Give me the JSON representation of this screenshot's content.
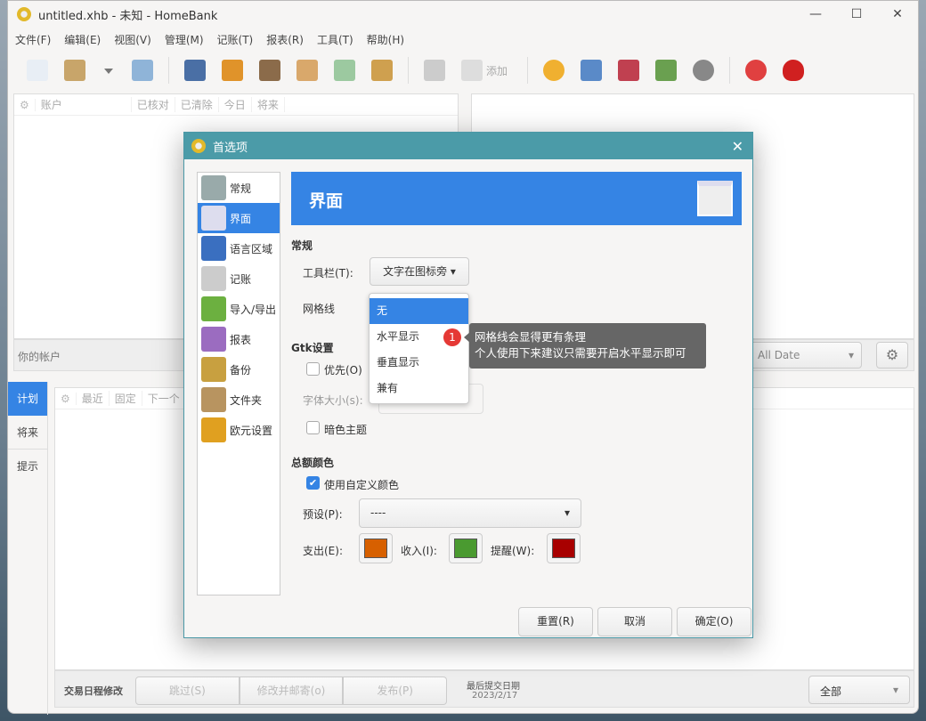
{
  "window": {
    "title": "untitled.xhb - 未知 - HomeBank",
    "controls": [
      "—",
      "☐",
      "✕"
    ]
  },
  "menu": [
    "文件(F)",
    "编辑(E)",
    "视图(V)",
    "管理(M)",
    "记账(T)",
    "报表(R)",
    "工具(T)",
    "帮助(H)"
  ],
  "toolbar": {
    "add_label": "添加",
    "colors": {
      "new": "#e8eef5",
      "open": "#c8a56a",
      "save": "#8fb4d8",
      "accounts": "#4a6fa5",
      "payees": "#e0932a",
      "categories": "#8b6b4a",
      "budget": "#d9a86b",
      "archive": "#9cc9a0",
      "assist": "#cfa04f",
      "help": "#ccc",
      "add": "#ddd",
      "pie": "#f0b030",
      "stats": "#5a8ac8",
      "trend": "#c04050",
      "balance": "#6aa050",
      "car": "#888",
      "lifebuoy": "#e04040",
      "heart": "#d02020"
    }
  },
  "accounts": {
    "columns": [
      "账户",
      "已核对",
      "已清除",
      "今日",
      "将来"
    ],
    "footer": "你的帐户"
  },
  "date_filter": {
    "value": "All Date"
  },
  "side_tabs": [
    "计划",
    "将来",
    "提示"
  ],
  "schedule": {
    "columns": [
      "最近",
      "固定",
      "下一个"
    ],
    "footer_label": "交易日程修改",
    "buttons": [
      "跳过(S)",
      "修改并邮寄(o)",
      "发布(P)"
    ],
    "last_post_label": "最后提交日期",
    "last_post_date": "2023/2/17",
    "filter": "全部"
  },
  "dialog": {
    "title": "首选项",
    "nav": [
      {
        "label": "常规",
        "color": "#9aa"
      },
      {
        "label": "界面",
        "color": "#dde"
      },
      {
        "label": "语言区域",
        "color": "#3a6fc0"
      },
      {
        "label": "记账",
        "color": "#ccc"
      },
      {
        "label": "导入/导出",
        "color": "#6cb040"
      },
      {
        "label": "报表",
        "color": "#9b6cc0"
      },
      {
        "label": "备份",
        "color": "#c8a040"
      },
      {
        "label": "文件夹",
        "color": "#b89460"
      },
      {
        "label": "欧元设置",
        "color": "#e0a020"
      }
    ],
    "selected_nav": 1,
    "banner": "界面",
    "general_section": "常规",
    "toolbar_label": "工具栏(T):",
    "toolbar_value": "文字在图标旁",
    "grid_label": "网格线",
    "grid_options": [
      "无",
      "水平显示",
      "垂直显示",
      "兼有"
    ],
    "grid_selected": 0,
    "gtk_section": "Gtk设置",
    "prefer_label": "优先(O)",
    "prefer_checked": false,
    "fontsize_label": "字体大小(s):",
    "dark_label": "暗色主题",
    "dark_checked": false,
    "amount_section": "总额颜色",
    "custom_color_label": "使用自定义颜色",
    "custom_color_checked": true,
    "preset_label": "预设(P):",
    "preset_value": "----",
    "expense_label": "支出(E):",
    "income_label": "收入(I):",
    "warning_label": "提醒(W):",
    "colors": {
      "expense": "#d76000",
      "income": "#4a9a30",
      "warning": "#a80000"
    },
    "buttons": {
      "reset": "重置(R)",
      "cancel": "取消",
      "ok": "确定(O)"
    }
  },
  "annotation": {
    "badge": "1",
    "line1": "网格线会显得更有条理",
    "line2": "个人使用下来建议只需要开启水平显示即可"
  }
}
